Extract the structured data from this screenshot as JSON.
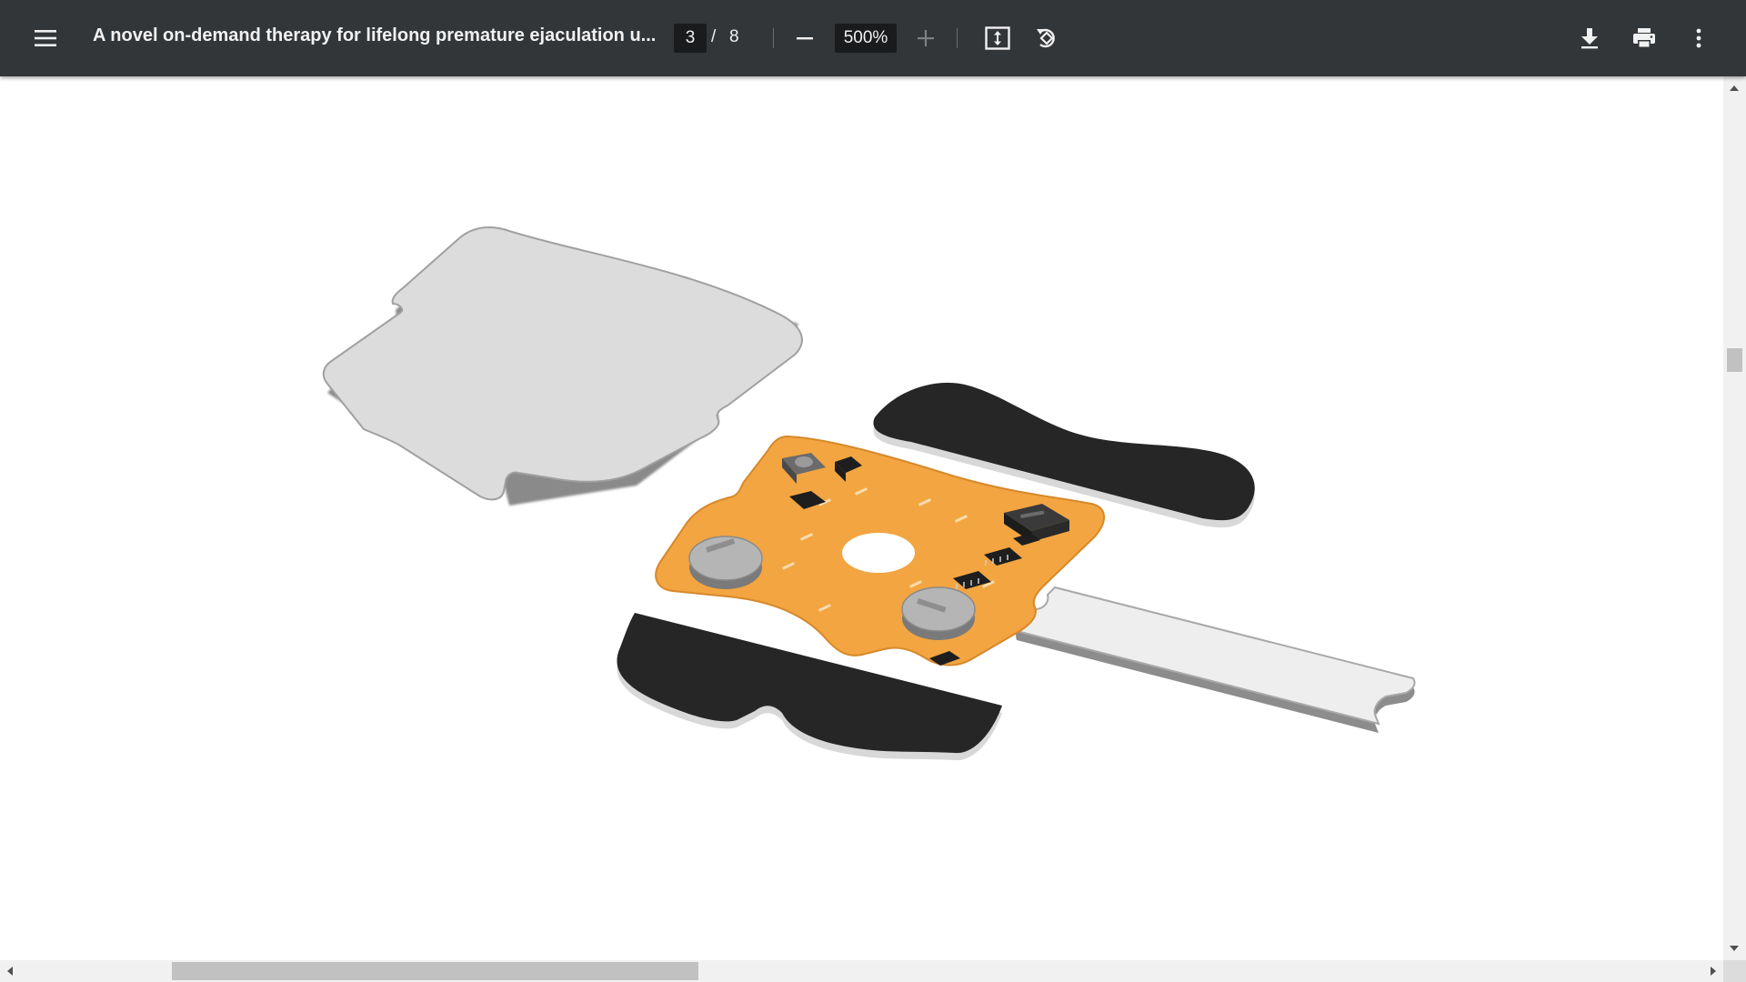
{
  "toolbar": {
    "title": "A novel on-demand therapy for lifelong premature ejaculation u...",
    "current_page": "3",
    "page_separator": "/",
    "total_pages": "8",
    "zoom": "500%",
    "icons": {
      "menu": "menu-icon",
      "zoom_out": "minus-icon",
      "zoom_in": "plus-icon",
      "fit": "fit-to-page-icon",
      "rotate": "rotate-icon",
      "download": "download-icon",
      "print": "print-icon",
      "more": "more-vert-icon"
    }
  },
  "colors": {
    "toolbar_bg": "#323639",
    "toolbar_text": "#f1f1f1",
    "input_bg": "#191b1c",
    "pcb_orange": "#f2a541",
    "pad_black": "#262626",
    "pad_gray": "#d9d9d9"
  }
}
